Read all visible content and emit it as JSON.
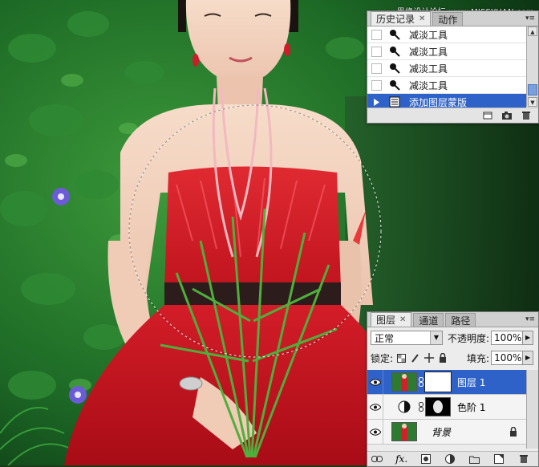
{
  "watermark": "思缘设计论坛 www.MISSYUAN.com",
  "history_panel": {
    "tabs": [
      {
        "label": "历史记录",
        "active": true,
        "closable": true
      },
      {
        "label": "动作",
        "active": false,
        "closable": false
      }
    ],
    "items": [
      {
        "label": "减淡工具",
        "icon": "dodge-tool-icon",
        "selected": false
      },
      {
        "label": "减淡工具",
        "icon": "dodge-tool-icon",
        "selected": false
      },
      {
        "label": "减淡工具",
        "icon": "dodge-tool-icon",
        "selected": false
      },
      {
        "label": "减淡工具",
        "icon": "dodge-tool-icon",
        "selected": false
      },
      {
        "label": "添加图层蒙版",
        "icon": "layer-mask-icon",
        "selected": true
      }
    ],
    "footer_icons": [
      "new-document-from-state-icon",
      "camera-snapshot-icon",
      "trash-icon"
    ]
  },
  "layers_panel": {
    "tabs": [
      {
        "label": "图层",
        "active": true,
        "closable": true
      },
      {
        "label": "通道",
        "active": false,
        "closable": false
      },
      {
        "label": "路径",
        "active": false,
        "closable": false
      }
    ],
    "blend_mode": "正常",
    "opacity_label": "不透明度:",
    "opacity_value": "100%",
    "lock_label": "锁定:",
    "fill_label": "填充:",
    "fill_value": "100%",
    "layers": [
      {
        "name": "图层 1",
        "selected": true,
        "visible": true,
        "has_mask": true,
        "italic": false
      },
      {
        "name": "色阶 1",
        "selected": false,
        "visible": true,
        "has_mask": true,
        "italic": false
      },
      {
        "name": "背景",
        "selected": false,
        "visible": true,
        "has_mask": false,
        "italic": true,
        "locked": true
      }
    ],
    "footer_icons": [
      "link-layers-icon",
      "fx-icon",
      "add-mask-icon",
      "adjustment-layer-icon",
      "new-group-icon",
      "new-layer-icon",
      "trash-icon"
    ]
  },
  "colors": {
    "selection_blue": "#2f62c8",
    "dress_red": "#d8202a",
    "foliage_green": "#1f6b2a"
  }
}
